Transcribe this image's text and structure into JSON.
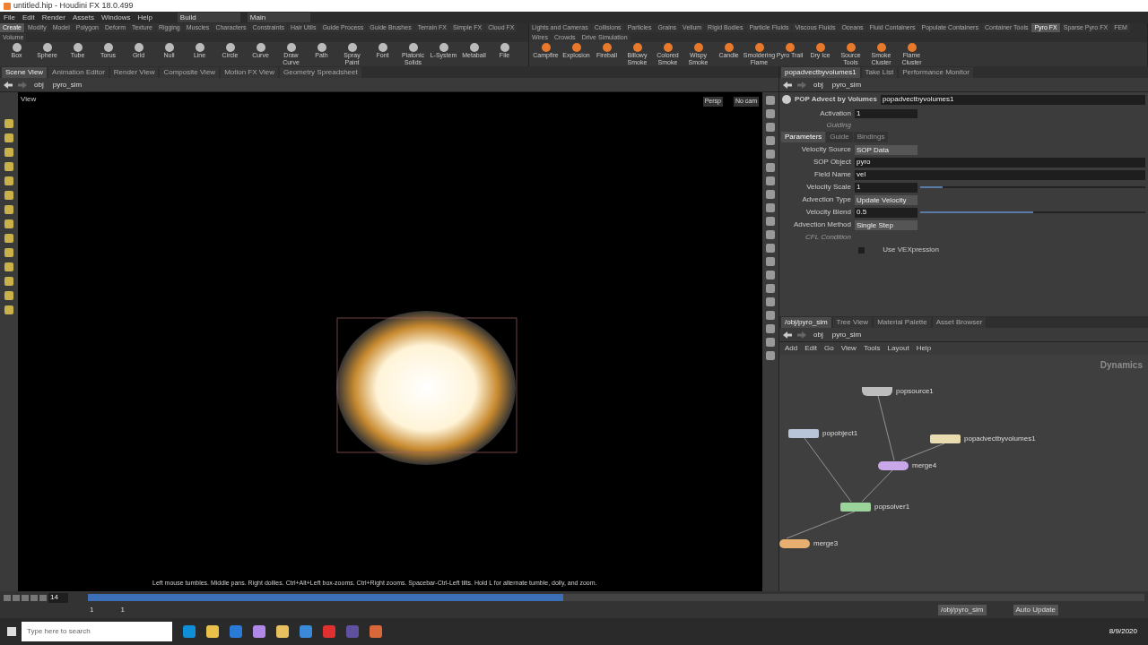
{
  "window": {
    "title": "untitled.hip - Houdini FX 18.0.499"
  },
  "menu": [
    "File",
    "Edit",
    "Render",
    "Assets",
    "Windows",
    "Help"
  ],
  "desktop": {
    "build": "Build",
    "main": "Main"
  },
  "shelf_left": {
    "tabs": [
      {
        "label": "Create",
        "selected": true
      },
      {
        "label": "Modify",
        "selected": false
      },
      {
        "label": "Model",
        "selected": false
      },
      {
        "label": "Polygon",
        "selected": false
      },
      {
        "label": "Deform",
        "selected": false
      },
      {
        "label": "Texture",
        "selected": false
      },
      {
        "label": "Rigging",
        "selected": false
      },
      {
        "label": "Muscles",
        "selected": false
      },
      {
        "label": "Characters",
        "selected": false
      },
      {
        "label": "Constraints",
        "selected": false
      },
      {
        "label": "Hair Utils",
        "selected": false
      },
      {
        "label": "Guide Process",
        "selected": false
      },
      {
        "label": "Guide Brushes",
        "selected": false
      },
      {
        "label": "Terrain FX",
        "selected": false
      },
      {
        "label": "Simple FX",
        "selected": false
      },
      {
        "label": "Cloud FX",
        "selected": false
      },
      {
        "label": "Volume",
        "selected": false
      }
    ],
    "tools": [
      "Box",
      "Sphere",
      "Tube",
      "Torus",
      "Grid",
      "Null",
      "Line",
      "Circle",
      "Curve",
      "Draw Curve",
      "Path",
      "Spray Paint",
      "Font",
      "Platonic Solids",
      "L-System",
      "Metaball",
      "File"
    ]
  },
  "shelf_right": {
    "tabs": [
      {
        "label": "Lights and Cameras",
        "selected": false
      },
      {
        "label": "Collisions",
        "selected": false
      },
      {
        "label": "Particles",
        "selected": false
      },
      {
        "label": "Grains",
        "selected": false
      },
      {
        "label": "Vellum",
        "selected": false
      },
      {
        "label": "Rigid Bodies",
        "selected": false
      },
      {
        "label": "Particle Fluids",
        "selected": false
      },
      {
        "label": "Viscous Fluids",
        "selected": false
      },
      {
        "label": "Oceans",
        "selected": false
      },
      {
        "label": "Fluid Containers",
        "selected": false
      },
      {
        "label": "Populate Containers",
        "selected": false
      },
      {
        "label": "Container Tools",
        "selected": false
      },
      {
        "label": "Pyro FX",
        "selected": true
      },
      {
        "label": "Sparse Pyro FX",
        "selected": false
      },
      {
        "label": "FEM",
        "selected": false
      },
      {
        "label": "Wires",
        "selected": false
      },
      {
        "label": "Crowds",
        "selected": false
      },
      {
        "label": "Drive Simulation",
        "selected": false
      }
    ],
    "tools": [
      "Campfire",
      "Explosion",
      "Fireball",
      "Billowy Smoke",
      "Colored Smoke",
      "Wispy Smoke",
      "Candle",
      "Smoldering Flame",
      "Pyro Trail",
      "Dry Ice",
      "Source Tools",
      "Smoke Cluster",
      "Flame Cluster"
    ]
  },
  "scene_pane": {
    "tabs": [
      {
        "label": "Scene View",
        "selected": true
      },
      {
        "label": "Animation Editor",
        "selected": false
      },
      {
        "label": "Render View",
        "selected": false
      },
      {
        "label": "Composite View",
        "selected": false
      },
      {
        "label": "Motion FX View",
        "selected": false
      },
      {
        "label": "Geometry Spreadsheet",
        "selected": false
      }
    ],
    "path": [
      "obj",
      "pyro_sim"
    ],
    "view_label": "View",
    "camera": "Persp",
    "cam_menu": "No cam",
    "hint": "Left mouse tumbles. Middle pans. Right dollies. Ctrl+Alt+Left box-zooms. Ctrl+Right zooms. Spacebar-Ctrl-Left tilts. Hold L for alternate tumble, dolly, and zoom."
  },
  "params_pane": {
    "tabs": [
      {
        "label": "popadvectbyvolumes1",
        "selected": true
      },
      {
        "label": "Take List",
        "selected": false
      },
      {
        "label": "Performance Monitor",
        "selected": false
      }
    ],
    "path": [
      "obj",
      "pyro_sim"
    ],
    "node_type": "POP Advect by Volumes",
    "node_name": "popadvectbyvolumes1",
    "activation": {
      "label": "Activation",
      "value": "1"
    },
    "guiding": {
      "label": "Guiding",
      "disabled": true
    },
    "param_tabs": [
      {
        "label": "Parameters",
        "selected": true
      },
      {
        "label": "Guide",
        "selected": false
      },
      {
        "label": "Bindings",
        "selected": false
      }
    ],
    "params": [
      {
        "kind": "menu",
        "label": "Velocity Source",
        "value": "SOP Data"
      },
      {
        "kind": "text",
        "label": "SOP Object",
        "value": "pyro"
      },
      {
        "kind": "text",
        "label": "Field Name",
        "value": "vel"
      },
      {
        "kind": "slider",
        "label": "Velocity Scale",
        "value": "1",
        "level": 0.1
      },
      {
        "kind": "menu",
        "label": "Advection Type",
        "value": "Update Velocity"
      },
      {
        "kind": "slider",
        "label": "Velocity Blend",
        "value": "0.5",
        "level": 0.5
      },
      {
        "kind": "menu",
        "label": "Advection Method",
        "value": "Single Step"
      },
      {
        "kind": "disabled",
        "label": "CFL Condition"
      },
      {
        "kind": "checkbox",
        "label": "Use VEXpression",
        "checked": false
      }
    ]
  },
  "network_pane": {
    "tabs": [
      {
        "label": "/obj/pyro_sim",
        "selected": true
      },
      {
        "label": "Tree View",
        "selected": false
      },
      {
        "label": "Material Palette",
        "selected": false
      },
      {
        "label": "Asset Browser",
        "selected": false
      }
    ],
    "path": [
      "obj",
      "pyro_sim"
    ],
    "menu": [
      "Add",
      "Edit",
      "Go",
      "View",
      "Tools",
      "Layout",
      "Help"
    ],
    "context": "Dynamics",
    "nodes": [
      {
        "name": "popsource1",
        "kind": "source",
        "color": "#bdbdbd"
      },
      {
        "name": "popobject1",
        "kind": "object",
        "color": "#b8c4d8"
      },
      {
        "name": "popadvectbyvolumes1",
        "kind": "force",
        "color": "#e8dcb0"
      },
      {
        "name": "merge4",
        "kind": "merge",
        "color": "#c8a8e8"
      },
      {
        "name": "popsolver1",
        "kind": "solver",
        "color": "#9ad49a"
      },
      {
        "name": "merge3",
        "kind": "merge",
        "color": "#e8b070"
      }
    ]
  },
  "timeline": {
    "frame": "14",
    "range_start": "1",
    "range_end": "1",
    "level": 0.45
  },
  "status": {
    "path": "/obj/pyro_sim",
    "update": "Auto Update"
  },
  "taskbar": {
    "search_placeholder": "Type here to search",
    "date": "8/9/2020"
  }
}
